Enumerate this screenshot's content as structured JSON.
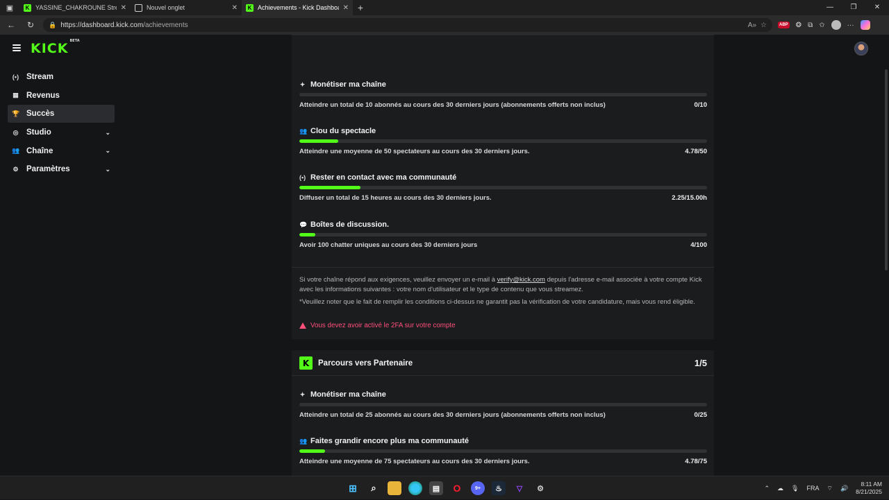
{
  "browser": {
    "tabs": [
      {
        "title": "YASSINE_CHAKROUNE Stream - V",
        "favicon": "kick-logo",
        "active": false
      },
      {
        "title": "Nouvel onglet",
        "favicon": "page-icon",
        "active": false
      },
      {
        "title": "Achievements - Kick Dashboard",
        "favicon": "kick-logo",
        "active": true
      }
    ],
    "url_base": "https://dashboard.kick.com",
    "url_path": "/achievements",
    "abp_label": "ABP"
  },
  "app": {
    "logo": "KICK",
    "logo_badge": "BETA",
    "sidebar": [
      {
        "label": "Stream",
        "icon": "broadcast-icon",
        "glyph": "(•)",
        "active": false,
        "expandable": false
      },
      {
        "label": "Revenus",
        "icon": "chart-icon",
        "glyph": "▦",
        "active": false,
        "expandable": false
      },
      {
        "label": "Succès",
        "icon": "trophy-icon",
        "glyph": "🏆",
        "active": true,
        "expandable": false
      },
      {
        "label": "Studio",
        "icon": "studio-icon",
        "glyph": "◎",
        "active": false,
        "expandable": true
      },
      {
        "label": "Chaîne",
        "icon": "users-icon",
        "glyph": "👥",
        "active": false,
        "expandable": true
      },
      {
        "label": "Paramètres",
        "icon": "gear-icon",
        "glyph": "⚙",
        "active": false,
        "expandable": true
      }
    ]
  },
  "card1": {
    "achievements": [
      {
        "title": "Monétiser ma chaîne",
        "icon": "sparkle-icon",
        "glyph": "✦",
        "desc": "Atteindre un total de 10 abonnés au cours des 30 derniers jours (abonnements offerts non inclus)",
        "value": "0/10",
        "progress": 0.0
      },
      {
        "title": "Clou du spectacle",
        "icon": "users-icon",
        "glyph": "👥",
        "desc": "Atteindre une moyenne de 50 spectateurs au cours des 30 derniers jours.",
        "value": "4.78/50",
        "progress": 0.0956
      },
      {
        "title": "Rester en contact avec ma communauté",
        "icon": "broadcast-icon",
        "glyph": "(•)",
        "desc": "Diffuser un total de 15 heures au cours des 30 derniers jours.",
        "value": "2.25/15.00h",
        "progress": 0.15
      },
      {
        "title": "Boîtes de discussion.",
        "icon": "chat-icon",
        "glyph": "💬",
        "desc": "Avoir 100 chatter uniques au cours des 30 derniers jours",
        "value": "4/100",
        "progress": 0.04
      }
    ],
    "note1_pre": "Si votre chaîne répond aux exigences, veuillez envoyer un e-mail à ",
    "note1_link": "verify@kick.com",
    "note1_post": " depuis l'adresse e-mail associée à votre compte Kick avec les informations suivantes : votre nom d'utilisateur et le type de contenu que vous streamez.",
    "note2": "*Veuillez noter que le fait de remplir les conditions ci-dessus ne garantit pas la vérification de votre candidature, mais vous rend éligible.",
    "warning": "Vous devez avoir activé le 2FA sur votre compte"
  },
  "card2": {
    "badge": "K",
    "title": "Parcours vers Partenaire",
    "count": "1/5",
    "achievements": [
      {
        "title": "Monétiser ma chaîne",
        "icon": "sparkle-icon",
        "glyph": "✦",
        "desc": "Atteindre un total de 25 abonnés au cours des 30 derniers jours (abonnements offerts non inclus)",
        "value": "0/25",
        "progress": 0.0
      },
      {
        "title": "Faites grandir encore plus ma communauté",
        "icon": "users-icon",
        "glyph": "👥",
        "desc": "Atteindre une moyenne de 75 spectateurs au cours des 30 derniers jours.",
        "value": "4.78/75",
        "progress": 0.0637
      }
    ]
  },
  "taskbar": {
    "language": "FRA",
    "time": "8:11 AM",
    "date": "8/21/2025",
    "discord_badge": "9+"
  }
}
